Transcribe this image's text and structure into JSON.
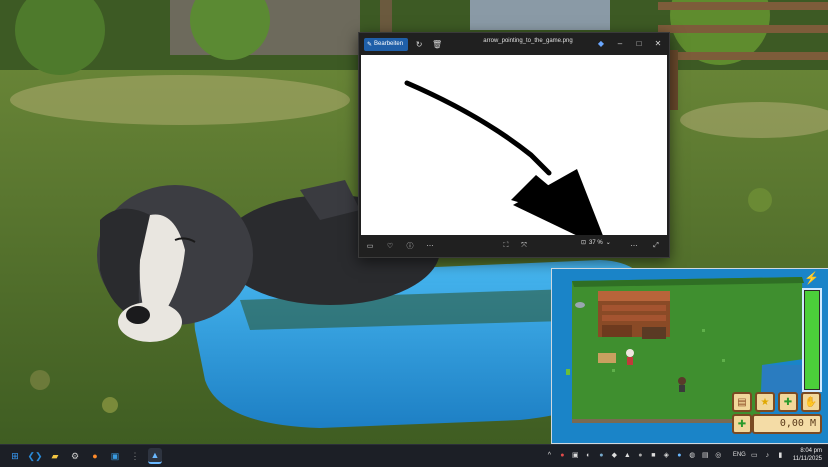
{
  "viewer": {
    "edit_label": "Bearbeiten",
    "file_name": "arrow_pointing_to_the_game.png",
    "zoom_level": "37 %"
  },
  "game": {
    "money": "0,00 M",
    "energy_level": 1.0
  },
  "taskbar": {
    "language": "ENG",
    "time": "8:04 pm",
    "date": "11/11/2025"
  },
  "icons": {
    "start": "windows-start-icon",
    "vscode": "vscode-icon",
    "explorer": "file-explorer-icon",
    "browser": "firefox-icon",
    "store": "store-icon",
    "photos": "photos-icon"
  }
}
